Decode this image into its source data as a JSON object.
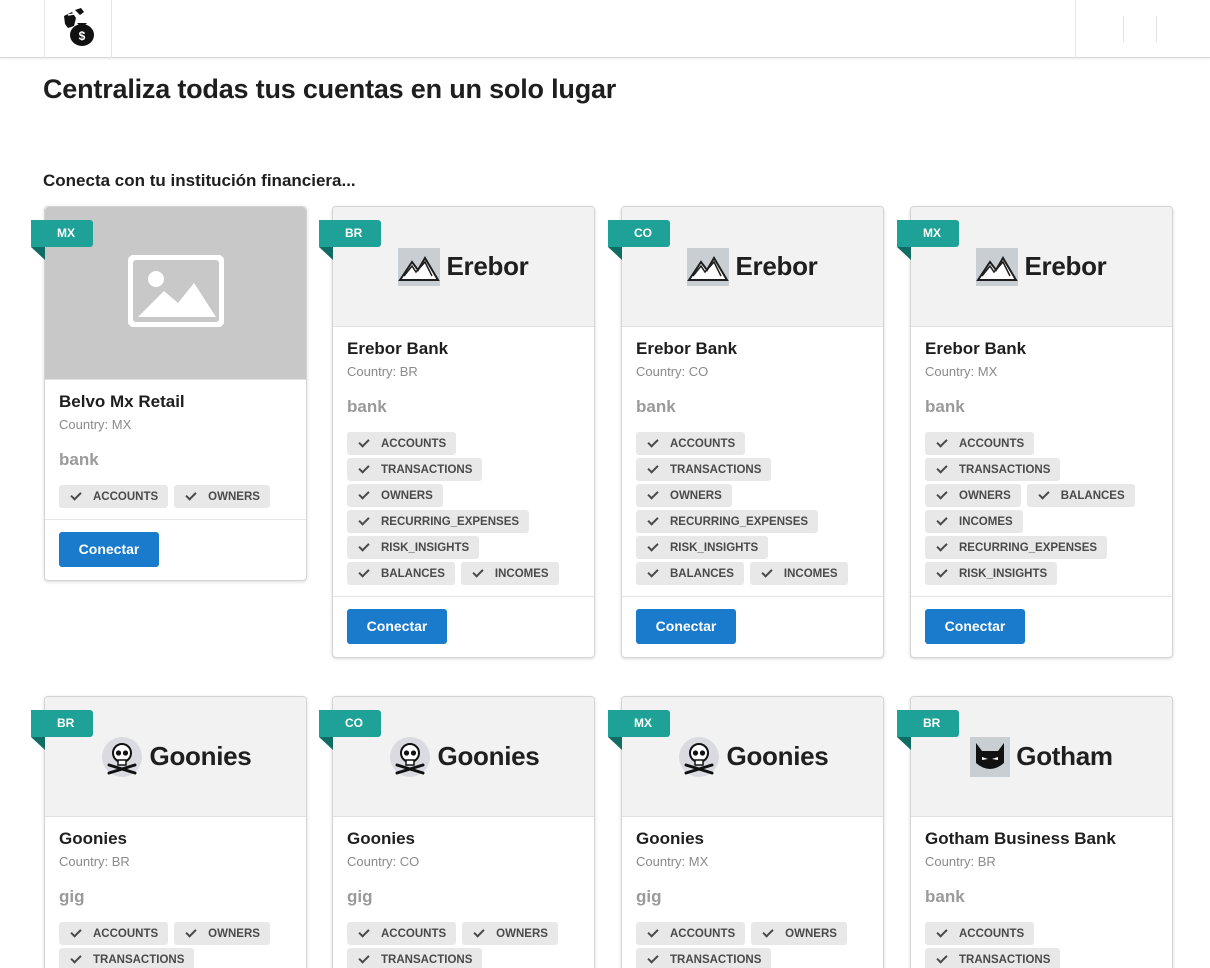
{
  "header": {
    "logo_icon": "money-bag-hand-icon"
  },
  "page_title": "Centraliza todas tus cuentas en un solo lugar",
  "section_title": "Conecta con tu institución financiera...",
  "colors": {
    "ribbon": "#1ea196",
    "button": "#1a7bcc",
    "tag_bg": "#e8e8e8"
  },
  "cards": [
    {
      "country_code": "MX",
      "logo_icon": "image-placeholder-icon",
      "name": "Belvo Mx Retail",
      "country": "Country: MX",
      "type": "bank",
      "tags": [
        "ACCOUNTS",
        "OWNERS"
      ],
      "button": "Conectar"
    },
    {
      "country_code": "BR",
      "logo_icon": "mountain-icon",
      "brand": "Erebor",
      "name": "Erebor Bank",
      "country": "Country: BR",
      "type": "bank",
      "tags": [
        "ACCOUNTS",
        "TRANSACTIONS",
        "OWNERS",
        "RECURRING_EXPENSES",
        "RISK_INSIGHTS",
        "BALANCES",
        "INCOMES"
      ],
      "button": "Conectar"
    },
    {
      "country_code": "CO",
      "logo_icon": "mountain-icon",
      "brand": "Erebor",
      "name": "Erebor Bank",
      "country": "Country: CO",
      "type": "bank",
      "tags": [
        "ACCOUNTS",
        "TRANSACTIONS",
        "OWNERS",
        "RECURRING_EXPENSES",
        "RISK_INSIGHTS",
        "BALANCES",
        "INCOMES"
      ],
      "button": "Conectar"
    },
    {
      "country_code": "MX",
      "logo_icon": "mountain-icon",
      "brand": "Erebor",
      "name": "Erebor Bank",
      "country": "Country: MX",
      "type": "bank",
      "tags": [
        "ACCOUNTS",
        "TRANSACTIONS",
        "OWNERS",
        "BALANCES",
        "INCOMES",
        "RECURRING_EXPENSES",
        "RISK_INSIGHTS"
      ],
      "button": "Conectar"
    },
    {
      "country_code": "BR",
      "logo_icon": "skull-icon",
      "brand": "Goonies",
      "name": "Goonies",
      "country": "Country: BR",
      "type": "gig",
      "tags": [
        "ACCOUNTS",
        "OWNERS",
        "TRANSACTIONS"
      ]
    },
    {
      "country_code": "CO",
      "logo_icon": "skull-icon",
      "brand": "Goonies",
      "name": "Goonies",
      "country": "Country: CO",
      "type": "gig",
      "tags": [
        "ACCOUNTS",
        "OWNERS",
        "TRANSACTIONS"
      ]
    },
    {
      "country_code": "MX",
      "logo_icon": "skull-icon",
      "brand": "Goonies",
      "name": "Goonies",
      "country": "Country: MX",
      "type": "gig",
      "tags": [
        "ACCOUNTS",
        "OWNERS",
        "TRANSACTIONS"
      ]
    },
    {
      "country_code": "BR",
      "logo_icon": "bat-mask-icon",
      "brand": "Gotham",
      "name": "Gotham Business Bank",
      "country": "Country: BR",
      "type": "bank",
      "tags": [
        "ACCOUNTS",
        "TRANSACTIONS"
      ]
    }
  ]
}
